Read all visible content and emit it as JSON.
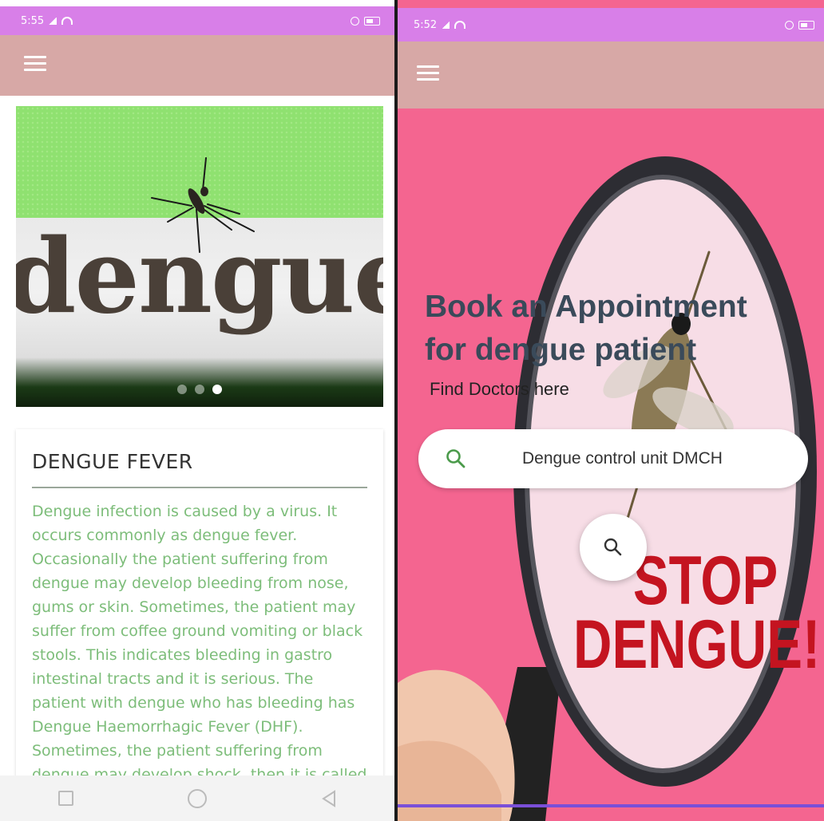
{
  "left_screen": {
    "status": {
      "time": "5:55"
    },
    "carousel": {
      "image_text": "dengue",
      "dots": 3,
      "active_dot": 3
    },
    "card": {
      "title": "DENGUE FEVER",
      "body": "Dengue infection is caused by a virus. It occurs commonly as dengue fever. Occasionally the patient suffering from dengue may develop bleeding from nose, gums or skin. Sometimes, the patient may suffer from coffee ground vomiting or black stools. This indicates bleeding in gastro intestinal tracts and it is serious. The patient with dengue who has bleeding has Dengue Haemorrhagic Fever (DHF). Sometimes, the patient suffering from dengue may develop shock, then it is called"
    },
    "colors": {
      "status_bar": "#d87fe8",
      "app_bar": "#d7a8a6",
      "body_text": "#7dbd7a"
    }
  },
  "right_screen": {
    "status": {
      "time": "5:52"
    },
    "hero": {
      "title_line1": "Book an Appointment",
      "title_line2": "for dengue patient",
      "subtitle": "Find Doctors here",
      "poster_line1": "STOP",
      "poster_line2": "DENGUE!"
    },
    "search": {
      "value": "Dengue control unit DMCH"
    },
    "colors": {
      "background": "#f46590",
      "accent": "#7a4fd8",
      "poster_text": "#c41420"
    }
  }
}
